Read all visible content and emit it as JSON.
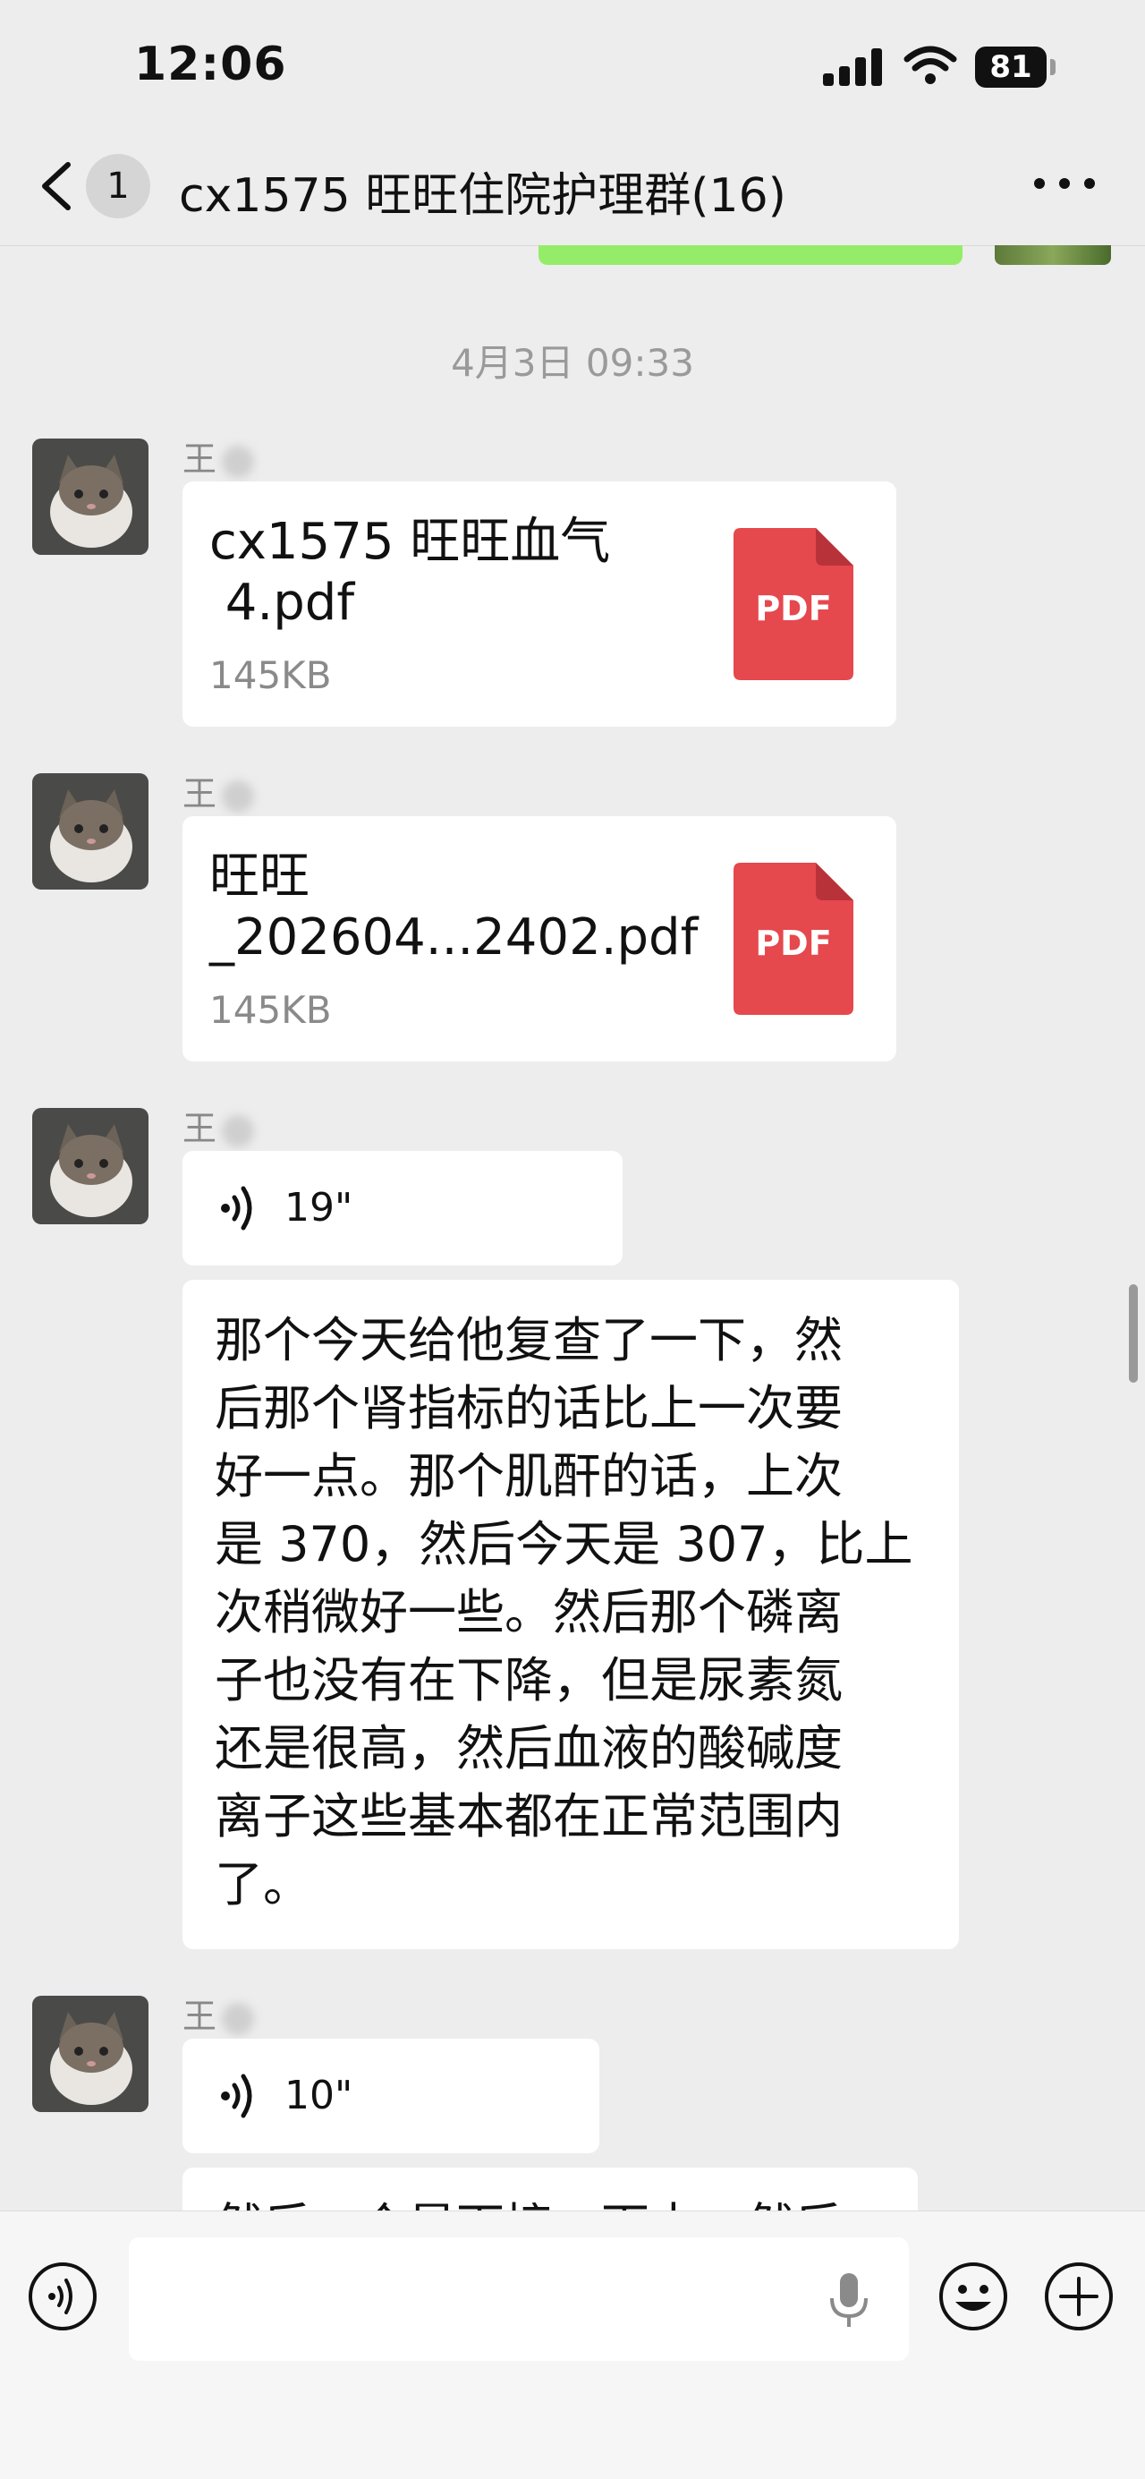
{
  "status_bar": {
    "time": "12:06",
    "battery": "81"
  },
  "nav": {
    "back_badge": "1",
    "title": "cx1575 旺旺住院护理群(16)"
  },
  "chat": {
    "timestamp": "4月3日 09:33",
    "sender_name": "王",
    "messages": [
      {
        "type": "file",
        "name_line1": "cx1575 旺旺血气",
        "name_line2": " 4.pdf",
        "size": "145KB",
        "badge": "PDF"
      },
      {
        "type": "file",
        "name_line1": "旺旺",
        "name_line2": "_202604...2402.pdf",
        "size": "145KB",
        "badge": "PDF"
      },
      {
        "type": "voice",
        "duration": "19\""
      },
      {
        "type": "text",
        "lines": [
          "那个今天给他复查了一下，然",
          "后那个肾指标的话比上一次要",
          "好一点。那个肌酐的话，上次",
          "是 370，然后今天是 307，比上",
          "次稍微好一些。然后那个磷离",
          "子也没有在下降，但是尿素氮",
          "还是很高，然后血液的酸碱度",
          "离子这些基本都在正常范围内",
          "了。"
        ]
      },
      {
        "type": "voice",
        "duration": "10\""
      },
      {
        "type": "text_partial",
        "text": "然后一个是下接一下中，然后"
      }
    ]
  },
  "input_bar": {
    "placeholder": ""
  },
  "colors": {
    "bubble_self": "#95ec69",
    "pdf_red": "#e5484d",
    "background": "#ededed"
  },
  "icons": [
    "back-chevron-icon",
    "more-dots-icon",
    "pdf-icon",
    "voice-wave-icon",
    "mic-icon",
    "emoji-icon",
    "plus-icon",
    "voice-mode-icon"
  ]
}
